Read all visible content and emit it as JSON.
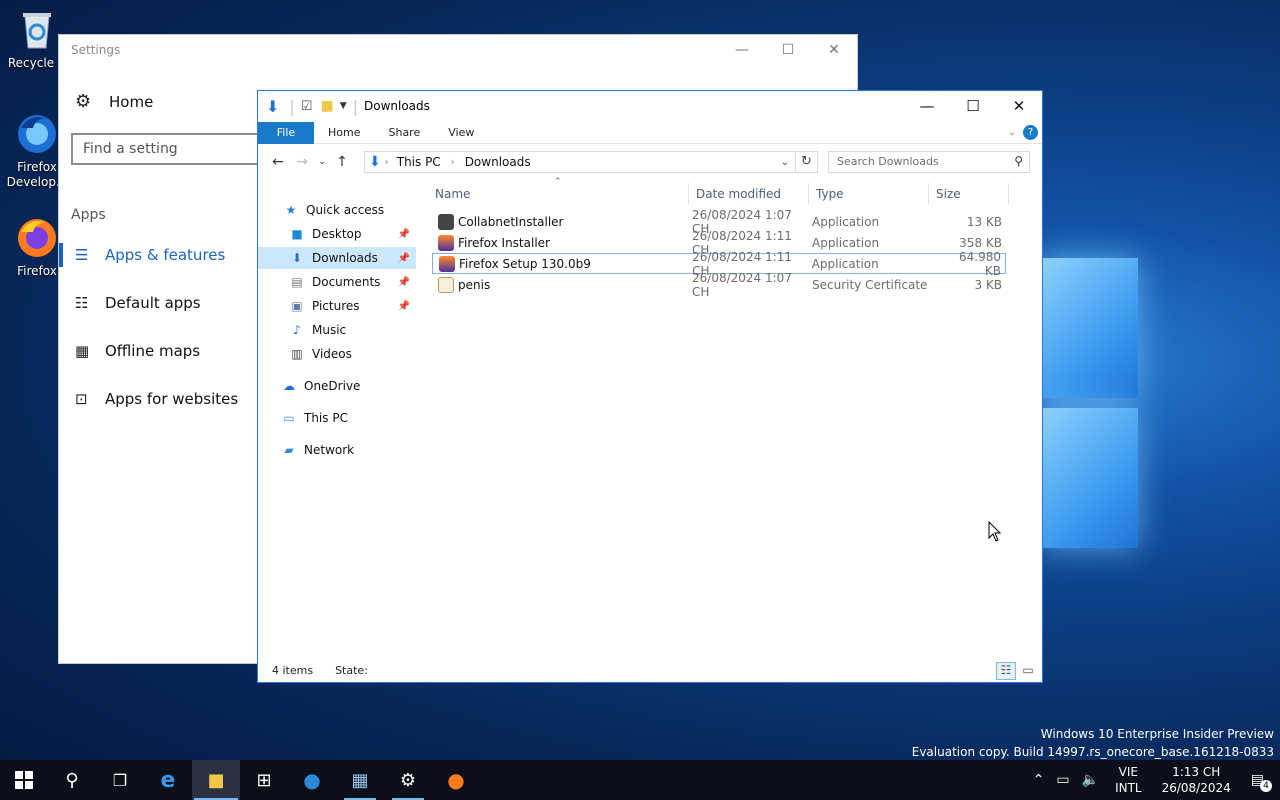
{
  "desktop": {
    "icons": [
      {
        "label": "Recycle B",
        "icon": "recycle-bin-icon"
      },
      {
        "label": "Firefox Develop...",
        "icon": "firefox-developer-icon"
      },
      {
        "label": "Firefox",
        "icon": "firefox-icon"
      }
    ],
    "watermark": {
      "line1": "Windows 10 Enterprise Insider Preview",
      "line2": "Evaluation copy. Build 14997.rs_onecore_base.161218-0833"
    }
  },
  "settings": {
    "title": "Settings",
    "home": "Home",
    "search_placeholder": "Find a setting",
    "section": "Apps",
    "nav": [
      {
        "label": "Apps & features",
        "icon": "list-icon",
        "active": true
      },
      {
        "label": "Default apps",
        "icon": "default-apps-icon"
      },
      {
        "label": "Offline maps",
        "icon": "map-icon"
      },
      {
        "label": "Apps for websites",
        "icon": "web-app-icon"
      }
    ]
  },
  "explorer": {
    "title": "Downloads",
    "ribbon_tabs": [
      "File",
      "Home",
      "Share",
      "View"
    ],
    "breadcrumb": [
      "This PC",
      "Downloads"
    ],
    "search_placeholder": "Search Downloads",
    "navpane": {
      "quick_access": "Quick access",
      "items": [
        "Desktop",
        "Downloads",
        "Documents",
        "Pictures",
        "Music",
        "Videos"
      ],
      "onedrive": "OneDrive",
      "thispc": "This PC",
      "network": "Network"
    },
    "columns": [
      "Name",
      "Date modified",
      "Type",
      "Size"
    ],
    "files": [
      {
        "name": "CollabnetInstaller",
        "date": "26/08/2024 1:07 CH",
        "type": "Application",
        "size": "13 KB",
        "icon": "installer-icon"
      },
      {
        "name": "Firefox Installer",
        "date": "26/08/2024 1:11 CH",
        "type": "Application",
        "size": "358 KB",
        "icon": "firefox-installer-icon"
      },
      {
        "name": "Firefox Setup 130.0b9",
        "date": "26/08/2024 1:11 CH",
        "type": "Application",
        "size": "64.980 KB",
        "icon": "firefox-setup-icon"
      },
      {
        "name": "penis",
        "date": "26/08/2024 1:07 CH",
        "type": "Security Certificate",
        "size": "3 KB",
        "icon": "certificate-icon"
      }
    ],
    "status": {
      "items": "4 items",
      "state": "State:"
    }
  },
  "taskbar": {
    "lang_line1": "VIE",
    "lang_line2": "INTL",
    "time": "1:13 CH",
    "date": "26/08/2024",
    "notifications": "4"
  }
}
